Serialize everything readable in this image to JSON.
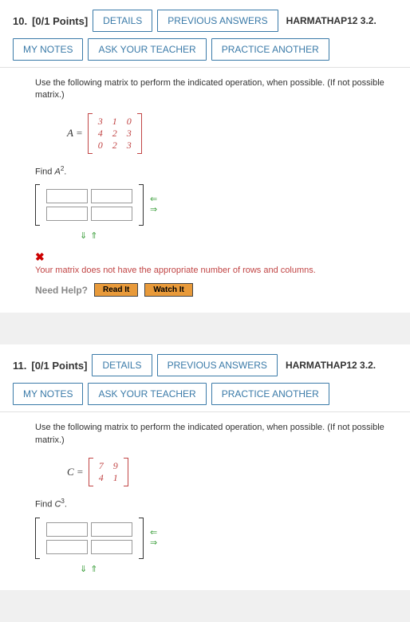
{
  "questions": [
    {
      "number": "10.",
      "points": "[0/1 Points]",
      "buttons": {
        "details": "DETAILS",
        "previous": "PREVIOUS ANSWERS",
        "notes": "MY NOTES",
        "ask": "ASK YOUR TEACHER",
        "practice": "PRACTICE ANOTHER"
      },
      "source": "HARMATHAP12 3.2.",
      "instruction": "Use the following matrix to perform the indicated operation, when possible. (If not possible matrix.)",
      "matrix_var": "A =",
      "matrix": [
        [
          "3",
          "1",
          "0"
        ],
        [
          "4",
          "2",
          "3"
        ],
        [
          "0",
          "2",
          "3"
        ]
      ],
      "find_label_pre": "Find ",
      "find_label_var": "A",
      "find_label_sup": "2",
      "find_label_post": ".",
      "error_icon": "✖",
      "error_msg": "Your matrix does not have the appropriate number of rows and columns.",
      "need_help": "Need Help?",
      "read_it": "Read It",
      "watch_it": "Watch It"
    },
    {
      "number": "11.",
      "points": "[0/1 Points]",
      "buttons": {
        "details": "DETAILS",
        "previous": "PREVIOUS ANSWERS",
        "notes": "MY NOTES",
        "ask": "ASK YOUR TEACHER",
        "practice": "PRACTICE ANOTHER"
      },
      "source": "HARMATHAP12 3.2.",
      "instruction": "Use the following matrix to perform the indicated operation, when possible. (If not possible matrix.)",
      "matrix_var": "C =",
      "matrix": [
        [
          "7",
          "9"
        ],
        [
          "4",
          "1"
        ]
      ],
      "find_label_pre": "Find ",
      "find_label_var": "C",
      "find_label_sup": "3",
      "find_label_post": "."
    }
  ]
}
